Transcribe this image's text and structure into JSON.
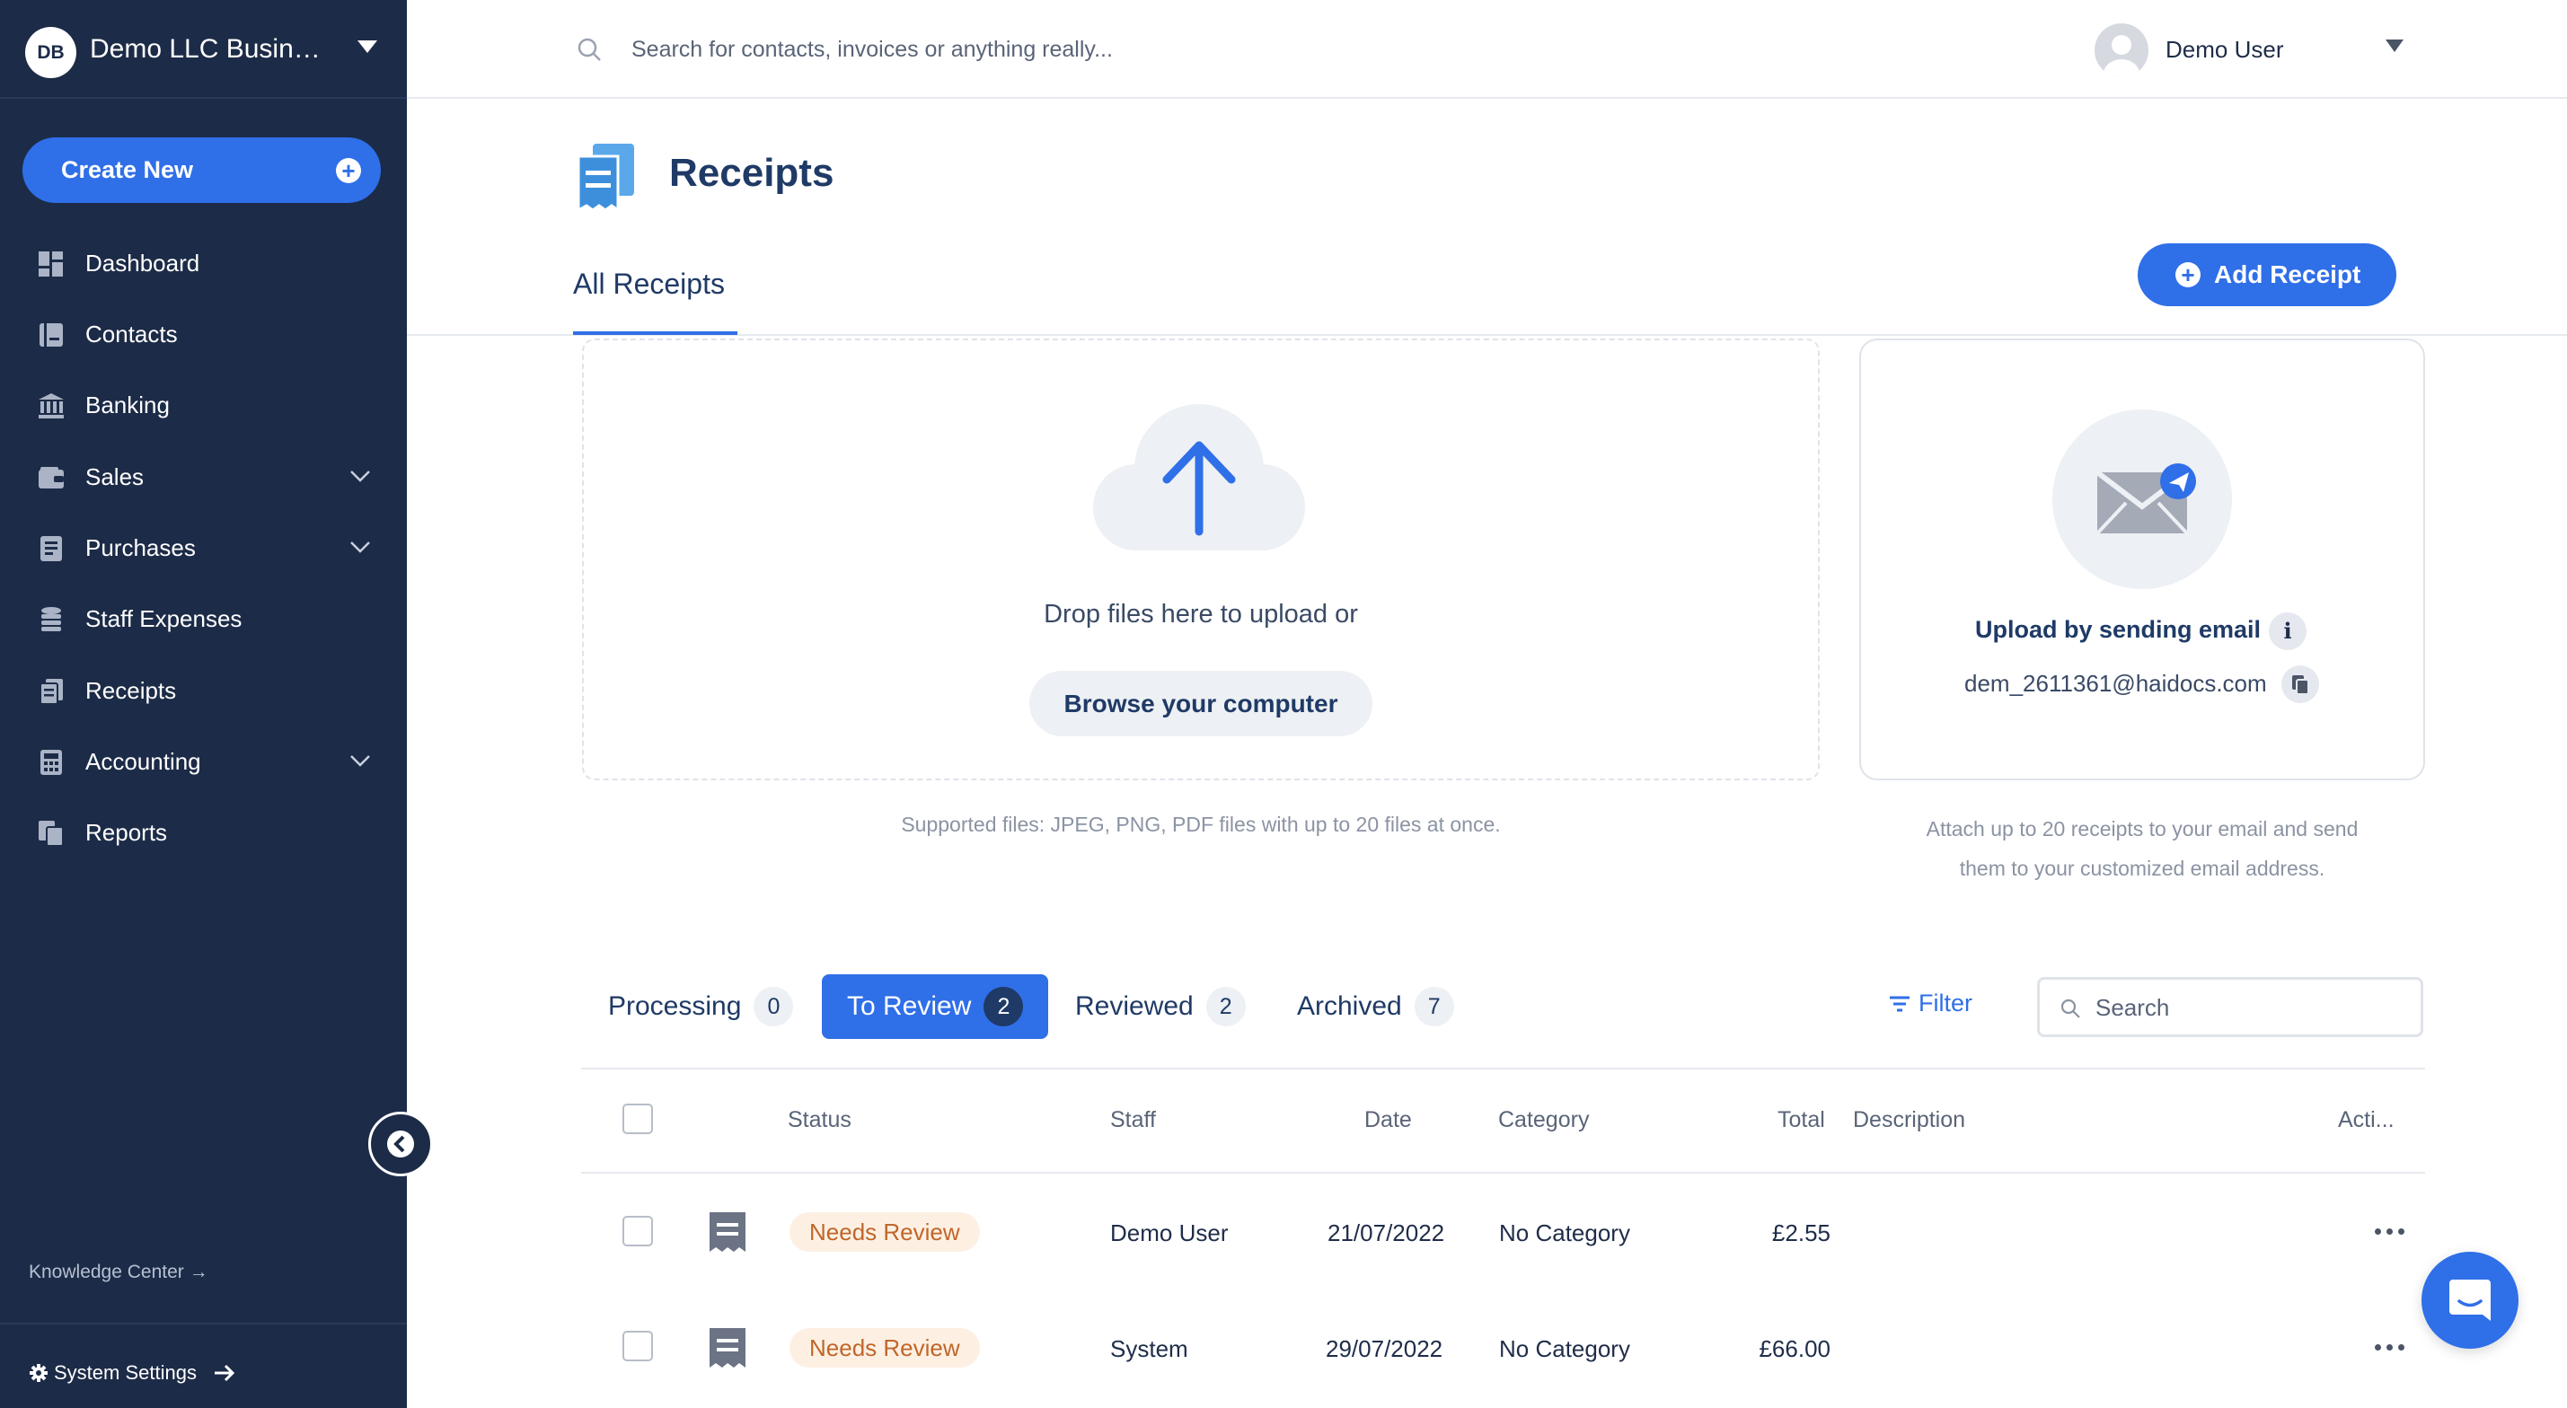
{
  "sidebar": {
    "avatar_initials": "DB",
    "company_name": "Demo LLC Business",
    "create_new_label": "Create New",
    "items": [
      {
        "label": "Dashboard",
        "icon": "dashboard-icon",
        "has_chevron": false
      },
      {
        "label": "Contacts",
        "icon": "contacts-icon",
        "has_chevron": false
      },
      {
        "label": "Banking",
        "icon": "bank-icon",
        "has_chevron": false
      },
      {
        "label": "Sales",
        "icon": "wallet-icon",
        "has_chevron": true
      },
      {
        "label": "Purchases",
        "icon": "purchases-icon",
        "has_chevron": true
      },
      {
        "label": "Staff Expenses",
        "icon": "coins-icon",
        "has_chevron": false
      },
      {
        "label": "Receipts",
        "icon": "receipt-icon",
        "has_chevron": false
      },
      {
        "label": "Accounting",
        "icon": "calculator-icon",
        "has_chevron": true
      },
      {
        "label": "Reports",
        "icon": "reports-icon",
        "has_chevron": false
      }
    ],
    "knowledge_center_label": "Knowledge Center →",
    "system_settings_label": "System Settings"
  },
  "topbar": {
    "search_placeholder": "Search for contacts, invoices or anything really...",
    "user_name": "Demo User"
  },
  "page": {
    "title": "Receipts",
    "tab_label": "All Receipts",
    "add_button_label": "Add Receipt"
  },
  "upload": {
    "drop_text": "Drop files here to upload or",
    "browse_label": "Browse your computer",
    "supported_text": "Supported files: JPEG, PNG, PDF files with up to 20 files at once."
  },
  "email_upload": {
    "title": "Upload by sending email",
    "address": "dem_2611361@haidocs.com",
    "help_line1": "Attach up to 20 receipts to your email and send",
    "help_line2": "them to your customized email address."
  },
  "status_tabs": [
    {
      "label": "Processing",
      "count": "0",
      "active": false
    },
    {
      "label": "To Review",
      "count": "2",
      "active": true
    },
    {
      "label": "Reviewed",
      "count": "2",
      "active": false
    },
    {
      "label": "Archived",
      "count": "7",
      "active": false
    }
  ],
  "filter_label": "Filter",
  "table_search_placeholder": "Search",
  "table": {
    "headers": {
      "status": "Status",
      "staff": "Staff",
      "date": "Date",
      "category": "Category",
      "total": "Total",
      "description": "Description",
      "actions": "Acti..."
    },
    "rows": [
      {
        "status": "Needs Review",
        "staff": "Demo User",
        "date": "21/07/2022",
        "category": "No Category",
        "total": "£2.55",
        "description": ""
      },
      {
        "status": "Needs Review",
        "staff": "System",
        "date": "29/07/2022",
        "category": "No Category",
        "total": "£66.00",
        "description": ""
      }
    ]
  },
  "colors": {
    "sidebar_bg": "#1c2b47",
    "accent": "#2f6fe8",
    "badge_bg": "#fdf0e3",
    "badge_text": "#c0662a"
  }
}
